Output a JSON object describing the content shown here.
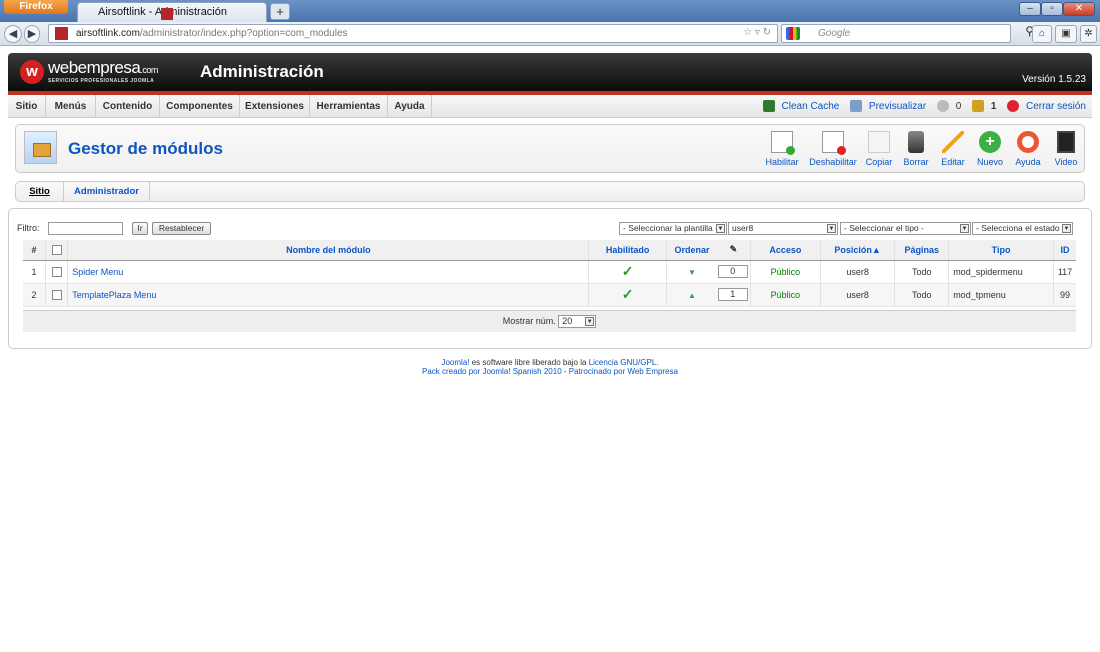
{
  "browser": {
    "menu_button": "Firefox",
    "tab_title": "Airsoftlink - Administración",
    "new_tab": "+",
    "url_host": "airsoftlink.com",
    "url_path": "/administrator/index.php?option=com_modules",
    "search_placeholder": "Google",
    "window_buttons": [
      "–",
      "▫",
      "✕"
    ]
  },
  "header": {
    "logo_letter": "w",
    "logo_text": "webempresa",
    "logo_suffix": ".com",
    "logo_tagline": "SERVICIOS PROFESIONALES JOOMLA",
    "title": "Administración",
    "version": "Versión 1.5.23"
  },
  "menu": {
    "items": [
      "Sitio",
      "Menús",
      "Contenido",
      "Componentes",
      "Extensiones",
      "Herramientas",
      "Ayuda"
    ],
    "right": {
      "clean_cache": "Clean Cache",
      "preview": "Previsualizar",
      "messages": "0",
      "users": "1",
      "logout": "Cerrar sesión"
    }
  },
  "page": {
    "title": "Gestor de módulos",
    "toolbar": [
      "Habilitar",
      "Deshabilitar",
      "Copiar",
      "Borrar",
      "Editar",
      "Nuevo",
      "Ayuda",
      "Video"
    ]
  },
  "submenu": [
    "Sitio",
    "Administrador"
  ],
  "filter": {
    "label": "Filtro:",
    "value": "",
    "go": "Ir",
    "reset": "Restablecer",
    "template_select": "- Seleccionar la plantilla -",
    "position_select": "user8",
    "type_select": "- Seleccionar el tipo -",
    "state_select": "- Selecciona el estado -"
  },
  "table": {
    "headers": [
      "#",
      "",
      "Nombre del módulo",
      "Habilitado",
      "Ordenar",
      "",
      "Acceso",
      "Posición▲",
      "Páginas",
      "Tipo",
      "ID"
    ],
    "rows": [
      {
        "num": "1",
        "name": "Spider Menu",
        "order": "0",
        "access": "Público",
        "position": "user8",
        "pages": "Todo",
        "type": "mod_spidermenu",
        "id": "117"
      },
      {
        "num": "2",
        "name": "TemplatePlaza Menu",
        "order": "1",
        "access": "Público",
        "position": "user8",
        "pages": "Todo",
        "type": "mod_tpmenu",
        "id": "99"
      }
    ],
    "footer_label": "Mostrar núm.",
    "page_size": "20"
  },
  "credits": {
    "line1_a": "Joomla!",
    "line1_b": " es software libre liberado bajo la ",
    "line1_c": "Licencia GNU/GPL.",
    "line2_a": "Pack creado por Joomla! Spanish 2010",
    "line2_b": " - ",
    "line2_c": "Patrocinado por Web Empresa"
  }
}
